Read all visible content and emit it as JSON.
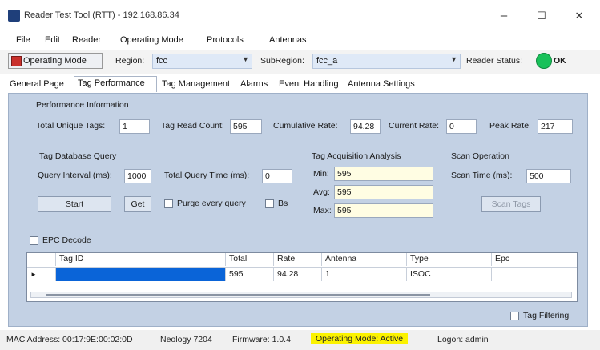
{
  "window": {
    "title": "Reader Test Tool (RTT) - 192.168.86.34",
    "minimize_glyph": "–",
    "maximize_glyph": "☐",
    "close_glyph": "✕"
  },
  "menu": [
    "File",
    "Edit",
    "Reader",
    "Operating Mode",
    "Protocols",
    "Antennas"
  ],
  "toolbar": {
    "operating_mode_label": "Operating Mode",
    "region_label": "Region:",
    "region_value": "fcc",
    "subregion_label": "SubRegion:",
    "subregion_value": "fcc_a",
    "reader_status_label": "Reader Status:",
    "reader_status_value": "OK",
    "reader_status_color": "#19c15a"
  },
  "tabs": [
    "General Page",
    "Tag Performance",
    "Tag Management",
    "Alarms",
    "Event Handling",
    "Antenna Settings"
  ],
  "performance": {
    "section_title": "Performance Information",
    "total_unique_label": "Total Unique Tags:",
    "total_unique_value": "1",
    "read_count_label": "Tag Read Count:",
    "read_count_value": "595",
    "cumulative_rate_label": "Cumulative Rate:",
    "cumulative_rate_value": "94.28",
    "current_rate_label": "Current Rate:",
    "current_rate_value": "0",
    "peak_rate_label": "Peak Rate:",
    "peak_rate_value": "217"
  },
  "db_query": {
    "title": "Tag Database Query",
    "interval_label": "Query Interval (ms):",
    "interval_value": "1000",
    "total_time_label": "Total Query Time (ms):",
    "total_time_value": "0",
    "start_label": "Start",
    "get_label": "Get",
    "purge_label": "Purge every query",
    "bs_label": "Bs"
  },
  "acquisition": {
    "title": "Tag Acquisition Analysis",
    "min_label": "Min:",
    "min_value": "595",
    "avg_label": "Avg:",
    "avg_value": "595",
    "max_label": "Max:",
    "max_value": "595"
  },
  "scan": {
    "title": "Scan Operation",
    "time_label": "Scan Time (ms):",
    "time_value": "500",
    "button_label": "Scan Tags"
  },
  "epc_decode_label": "EPC Decode",
  "grid": {
    "headers": [
      "Tag ID",
      "Total",
      "Rate",
      "Antenna",
      "Type",
      "Epc"
    ],
    "rows": [
      {
        "marker": "►",
        "tag_id": "",
        "total": "595",
        "rate": "94.28",
        "antenna": "1",
        "type": "ISOC",
        "epc": ""
      }
    ]
  },
  "tag_filtering_label": "Tag Filtering",
  "statusbar": {
    "mac": "MAC Address: 00:17:9E:00:02:0D",
    "neology": "Neology 7204",
    "firmware": "Firmware: 1.0.4",
    "opmode": "Operating Mode: Active",
    "login": "Logon: admin"
  }
}
